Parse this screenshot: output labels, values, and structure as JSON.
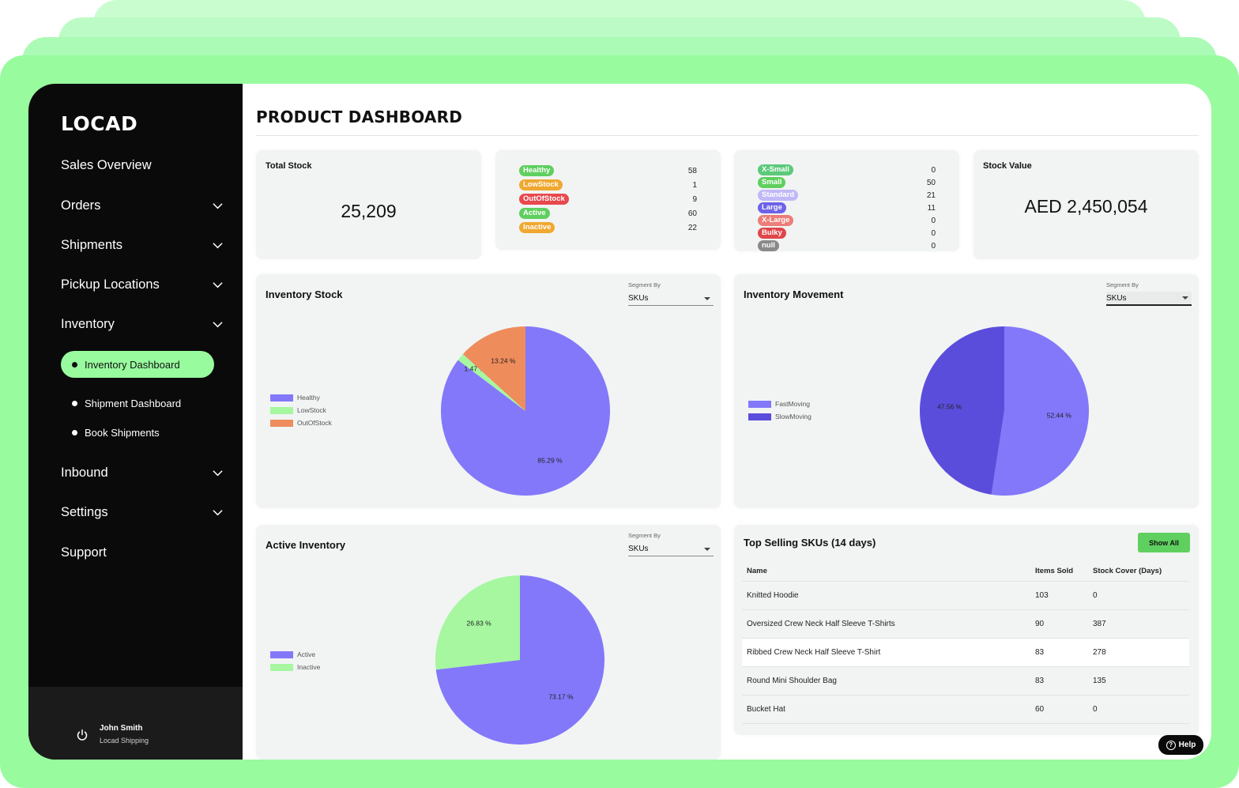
{
  "brand": {
    "logo_text": "LOCAD",
    "accent_color": "#98fb9e"
  },
  "sidebar": {
    "items": [
      {
        "label": "Sales Overview",
        "expandable": false
      },
      {
        "label": "Orders",
        "expandable": true
      },
      {
        "label": "Shipments",
        "expandable": true
      },
      {
        "label": "Pickup Locations",
        "expandable": true
      },
      {
        "label": "Inventory",
        "expandable": true,
        "expanded": true
      },
      {
        "label": "Inbound",
        "expandable": true
      },
      {
        "label": "Settings",
        "expandable": true
      },
      {
        "label": "Support",
        "expandable": false
      }
    ],
    "inventory_sub_items": [
      {
        "label": "Inventory Dashboard",
        "active": true
      },
      {
        "label": "Shipment Dashboard",
        "active": false
      },
      {
        "label": "Book Shipments",
        "active": false
      }
    ],
    "user": {
      "name": "John Smith",
      "org": "Locad Shipping",
      "icon": "power-icon"
    }
  },
  "page": {
    "title": "PRODUCT DASHBOARD"
  },
  "summary": {
    "total_stock": {
      "label": "Total Stock",
      "value": "25,209"
    },
    "status_counts": [
      {
        "label": "Healthy",
        "value": "58",
        "color": "#5fcf5f"
      },
      {
        "label": "LowStock",
        "value": "1",
        "color": "#f0a830"
      },
      {
        "label": "OutOfStock",
        "value": "9",
        "color": "#e8484e"
      },
      {
        "label": "Active",
        "value": "60",
        "color": "#5fcf5f"
      },
      {
        "label": "Inactive",
        "value": "22",
        "color": "#f0a830"
      }
    ],
    "size_counts": [
      {
        "label": "X-Small",
        "value": "0",
        "color": "#5cc97a"
      },
      {
        "label": "Small",
        "value": "50",
        "color": "#5fcf5f"
      },
      {
        "label": "Standard",
        "value": "21",
        "color": "#c1b8f7"
      },
      {
        "label": "Large",
        "value": "11",
        "color": "#6d62ea"
      },
      {
        "label": "X-Large",
        "value": "0",
        "color": "#ec7d78"
      },
      {
        "label": "Bulky",
        "value": "0",
        "color": "#e0464a"
      },
      {
        "label": "null",
        "value": "0",
        "color": "#8a8a8a"
      }
    ],
    "stock_value": {
      "label": "Stock Value",
      "value": "AED 2,450,054"
    }
  },
  "segment": {
    "label": "Segment By",
    "selected": "SKUs"
  },
  "chart_data": [
    {
      "type": "pie",
      "title": "Inventory Stock",
      "categories": [
        "Healthy",
        "LowStock",
        "OutOfStock"
      ],
      "values": [
        85.29,
        1.47,
        13.24
      ],
      "labels": [
        "85.29 %",
        "1.47 %",
        "13.24 %"
      ],
      "colors": [
        "#8378fa",
        "#a6f7a0",
        "#ef8c5c"
      ],
      "legend": "left"
    },
    {
      "type": "pie",
      "title": "Inventory Movement",
      "categories": [
        "FastMoving",
        "SlowMoving"
      ],
      "values": [
        52.44,
        47.56
      ],
      "labels": [
        "52.44 %",
        "47.56 %"
      ],
      "colors": [
        "#8378fa",
        "#5b4ddb"
      ],
      "legend": "left"
    },
    {
      "type": "pie",
      "title": "Active Inventory",
      "categories": [
        "Active",
        "Inactive"
      ],
      "values": [
        73.17,
        26.83
      ],
      "labels": [
        "73.17 %",
        "26.83 %"
      ],
      "colors": [
        "#8378fa",
        "#a6f7a0"
      ],
      "legend": "left"
    }
  ],
  "top_selling": {
    "title": "Top Selling SKUs (14 days)",
    "show_all_label": "Show All",
    "columns": [
      "Name",
      "Items Sold",
      "Stock Cover (Days)"
    ],
    "rows": [
      {
        "name": "Knitted Hoodie",
        "items_sold": "103",
        "stock_cover": "0"
      },
      {
        "name": "Oversized Crew Neck Half Sleeve T-Shirts",
        "items_sold": "90",
        "stock_cover": "387"
      },
      {
        "name": "Ribbed Crew Neck Half Sleeve T-Shirt",
        "items_sold": "83",
        "stock_cover": "278"
      },
      {
        "name": "Round Mini Shoulder Bag",
        "items_sold": "83",
        "stock_cover": "135"
      },
      {
        "name": "Bucket Hat",
        "items_sold": "60",
        "stock_cover": "0"
      }
    ]
  },
  "help": {
    "label": "Help"
  }
}
